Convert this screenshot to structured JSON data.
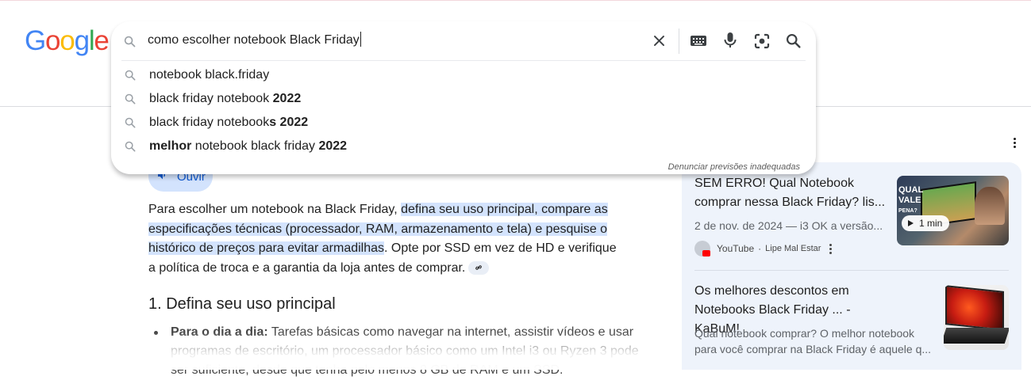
{
  "logo": {
    "letters": [
      "G",
      "o",
      "o",
      "g",
      "l",
      "e"
    ],
    "colors": [
      "#4285F4",
      "#EA4335",
      "#FBBC05",
      "#4285F4",
      "#34A853",
      "#EA4335"
    ]
  },
  "search": {
    "query": "como escolher notebook Black Friday",
    "suggestions": [
      {
        "parts": [
          "notebook black.friday"
        ],
        "bold": [
          false
        ]
      },
      {
        "parts": [
          "black friday notebook ",
          "2022"
        ],
        "bold": [
          false,
          true
        ]
      },
      {
        "parts": [
          "black friday notebook",
          "s 2022"
        ],
        "bold": [
          false,
          true
        ]
      },
      {
        "parts": [
          "melhor",
          " notebook black friday ",
          "2022"
        ],
        "bold": [
          true,
          false,
          true
        ]
      }
    ],
    "report_label": "Denunciar previsões inadequadas"
  },
  "ai_overview": {
    "listen_label": "Ouvir",
    "answer_intro": "Para escolher um notebook na Black Friday, ",
    "answer_highlight": "defina seu uso principal, compare as especificações técnicas (processador, RAM, armazenamento e tela) e pesquise o histórico de preços para evitar armadilhas",
    "answer_rest": ". Opte por SSD em vez de HD e verifique a política de troca e a garantia da loja antes de comprar.",
    "heading": "1. Defina seu uso principal",
    "bullet_label": "Para o dia a dia:",
    "bullet_text": " Tarefas básicas como navegar na internet, assistir vídeos e usar programas de escritório, um processador básico como um Intel i3 ou Ryzen 3 pode ser suficiente, desde que tenha pelo menos 8 GB de RAM e um SSD."
  },
  "sidebar": {
    "cards": [
      {
        "title": "SEM ERRO! Qual Notebook comprar nessa Black Friday? lis...",
        "meta": "2 de nov. de 2024 — i3 OK a versão...",
        "source": "YouTube",
        "author": "Lipe Mal Estar",
        "duration": "1 min",
        "thumb_text": [
          "QUAL",
          "VALE",
          "PENA?"
        ]
      },
      {
        "title": "Os melhores descontos em Notebooks Black Friday ... - KaBuM!",
        "snippet": "Qual notebook comprar? O melhor notebook para você comprar na Black Friday é aquele q..."
      }
    ]
  }
}
